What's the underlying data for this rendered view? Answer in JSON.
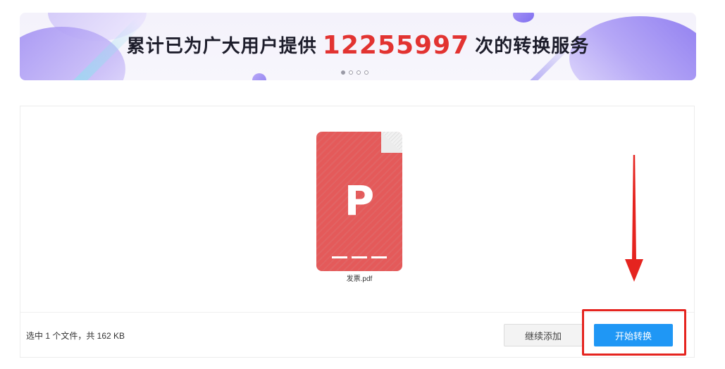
{
  "banner": {
    "prefix": "累计已为广大用户提供",
    "count": "12255997",
    "suffix": "次的转换服务",
    "slides": 4,
    "active_slide": 1
  },
  "file": {
    "icon_letter": "P",
    "name": "发票.pdf",
    "icon_color": "#e45a5a"
  },
  "footer": {
    "summary": "选中 1 个文件，共 162 KB",
    "add_label": "继续添加",
    "start_label": "开始转换"
  },
  "colors": {
    "accent": "#1f97f5",
    "highlight": "#e5241f",
    "count": "#e23331"
  }
}
